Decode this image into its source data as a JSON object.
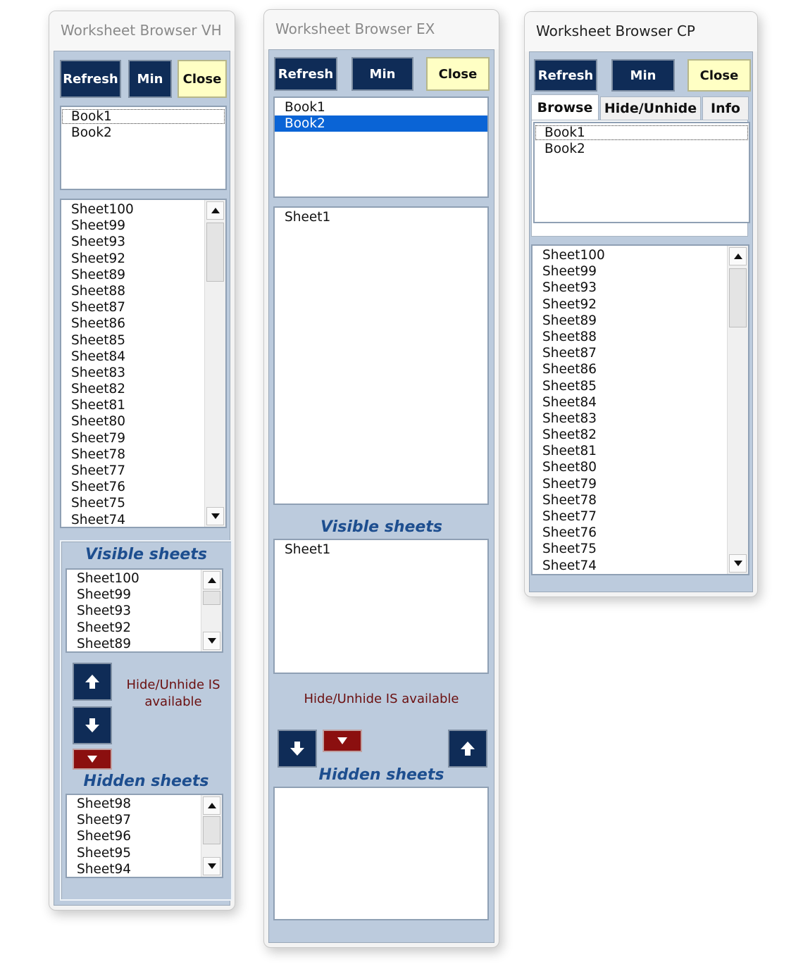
{
  "colors": {
    "navy": "#0f2c57",
    "close_yellow": "#ffffc4",
    "client_blue": "#bccbdd",
    "label_blue": "#1d4e8f",
    "status_red": "#6b1010",
    "dark_red": "#8b0f0f",
    "selection": "#0a64d6"
  },
  "window_vh": {
    "title": "Worksheet Browser VH",
    "buttons": {
      "refresh": "Refresh",
      "min": "Min",
      "close": "Close"
    },
    "books": [
      "Book1",
      "Book2"
    ],
    "sheets": [
      "Sheet100",
      "Sheet99",
      "Sheet93",
      "Sheet92",
      "Sheet89",
      "Sheet88",
      "Sheet87",
      "Sheet86",
      "Sheet85",
      "Sheet84",
      "Sheet83",
      "Sheet82",
      "Sheet81",
      "Sheet80",
      "Sheet79",
      "Sheet78",
      "Sheet77",
      "Sheet76",
      "Sheet75",
      "Sheet74"
    ],
    "visible_label": "Visible sheets",
    "visible_sheets": [
      "Sheet100",
      "Sheet99",
      "Sheet93",
      "Sheet92",
      "Sheet89"
    ],
    "status_text": "Hide/Unhide IS available",
    "hidden_label": "Hidden sheets",
    "hidden_sheets": [
      "Sheet98",
      "Sheet97",
      "Sheet96",
      "Sheet95",
      "Sheet94"
    ]
  },
  "window_ex": {
    "title": "Worksheet Browser EX",
    "buttons": {
      "refresh": "Refresh",
      "min": "Min",
      "close": "Close"
    },
    "books": [
      "Book1",
      "Book2"
    ],
    "sheets": [
      "Sheet1"
    ],
    "visible_label": "Visible sheets",
    "visible_sheets": [
      "Sheet1"
    ],
    "status_text": "Hide/Unhide IS available",
    "hidden_label": "Hidden sheets",
    "hidden_sheets": []
  },
  "window_cp": {
    "title": "Worksheet Browser CP",
    "buttons": {
      "refresh": "Refresh",
      "min": "Min",
      "close": "Close"
    },
    "tabs": [
      "Browse",
      "Hide/Unhide",
      "Info"
    ],
    "books": [
      "Book1",
      "Book2"
    ],
    "sheets": [
      "Sheet100",
      "Sheet99",
      "Sheet93",
      "Sheet92",
      "Sheet89",
      "Sheet88",
      "Sheet87",
      "Sheet86",
      "Sheet85",
      "Sheet84",
      "Sheet83",
      "Sheet82",
      "Sheet81",
      "Sheet80",
      "Sheet79",
      "Sheet78",
      "Sheet77",
      "Sheet76",
      "Sheet75",
      "Sheet74"
    ]
  }
}
